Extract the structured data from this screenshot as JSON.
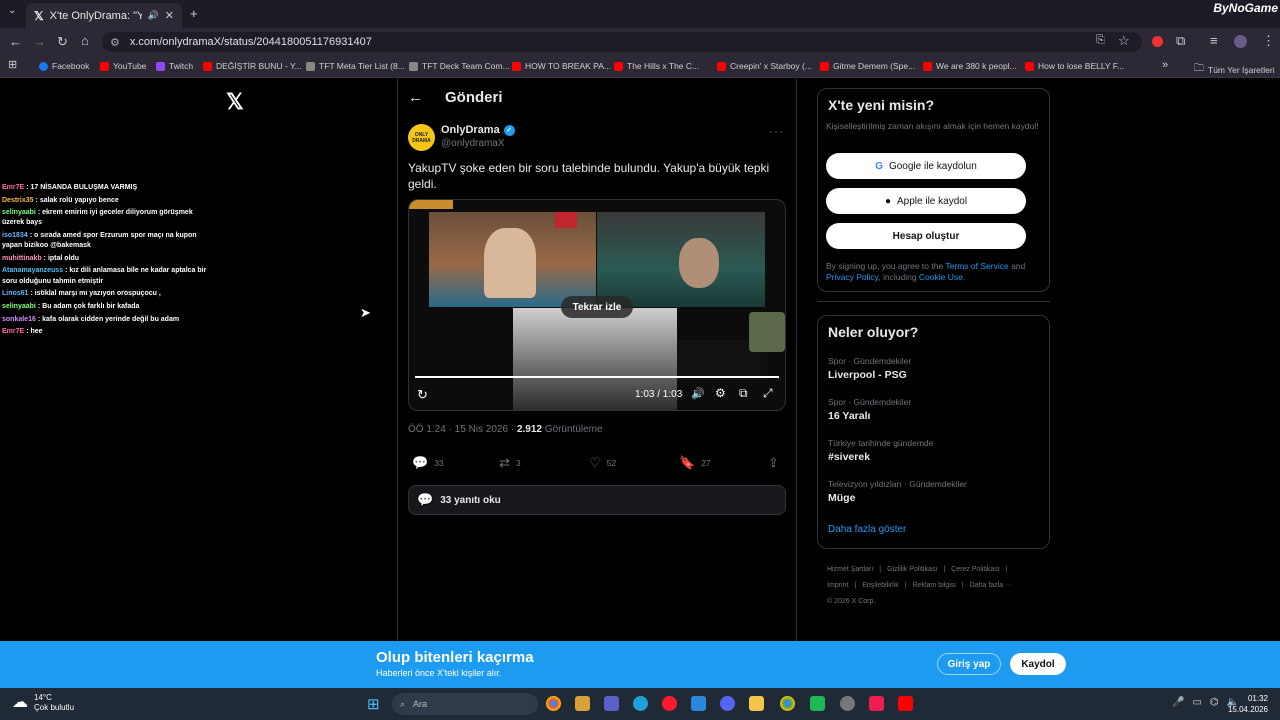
{
  "browser": {
    "tab_title": "X'te OnlyDrama: \"YakupTV ",
    "url": "x.com/onlydramaX/status/2044180051176931407",
    "brand": "ByNoGame",
    "bookmarks": [
      {
        "label": "Facebook",
        "color": "#1877f2"
      },
      {
        "label": "YouTube",
        "color": "#ff0000"
      },
      {
        "label": "Twitch",
        "color": "#9146ff"
      },
      {
        "label": "DEĞİŞTİR BUNU - Y...",
        "color": "#ff0000"
      },
      {
        "label": "TFT Meta Tier List (8...",
        "color": "#888888"
      },
      {
        "label": "TFT Deck Team Com...",
        "color": "#888888"
      },
      {
        "label": "HOW TO BREAK PA...",
        "color": "#ff0000"
      },
      {
        "label": "The Hills x The C...",
        "color": "#ff0000"
      },
      {
        "label": "Creepin' x Starboy (...",
        "color": "#ff0000"
      },
      {
        "label": "Gitme Demem (Spe...",
        "color": "#ff0000"
      },
      {
        "label": "We are 380 k peopl...",
        "color": "#ff0000"
      },
      {
        "label": "How to lose BELLY F...",
        "color": "#ff0000"
      }
    ],
    "all_bookmarks": "Tüm Yer İşaretleri"
  },
  "chat": [
    {
      "user": "Emr7E",
      "color": "#ff6b9a",
      "text": "17 NİSANDA BULUŞMA VARMIŞ"
    },
    {
      "user": "Destrix35",
      "color": "#ffb347",
      "text": "salak rolü yapıyo bence"
    },
    {
      "user": "selinyaabi",
      "color": "#7fff7f",
      "text": "ekrem emirim iyi geceler diliyorum görüşmek üzerek bays"
    },
    {
      "user": "iso1834",
      "color": "#6fb6ff",
      "text": "o sırada amed spor Erzurum spor maçı na kupon yapan bizikoo @bakemask"
    },
    {
      "user": "muhittinakb",
      "color": "#ff8fb1",
      "text": "iptal oldu"
    },
    {
      "user": "Atanamayanzeuss",
      "color": "#4fc3f7",
      "text": "kız dili anlamasa bile ne kadar aptalca bir soru olduğunu tahmin etmiştir"
    },
    {
      "user": "Linos61",
      "color": "#64b5f6",
      "text": "istiklal marşı mı yazıyon orospuçocu ,"
    },
    {
      "user": "selinyaabi",
      "color": "#7fff7f",
      "text": "Bu adam çok farklı bir kafada"
    },
    {
      "user": "sonkale16",
      "color": "#d18cff",
      "text": "kafa olarak cidden yerinde değil bu adam"
    },
    {
      "user": "Emr7E",
      "color": "#ff6b9a",
      "text": "hee"
    }
  ],
  "post": {
    "header": "Gönderi",
    "author": "OnlyDrama",
    "handle": "@onlydramaX",
    "text": "YakupTV şoke eden bir soru talebinde bulundu. Yakup'a büyük tepki geldi.",
    "replay_label": "Tekrar izle",
    "video_time": "1:03 / 1:03",
    "time": "ÖÖ 1:24 · 15 Nis 2026 · ",
    "views": "2.912",
    "views_label": " Görüntüleme",
    "replies": "33",
    "reposts": "3",
    "likes": "52",
    "bookmarks": "27",
    "read_replies": "33 yanıtı oku",
    "video_progress": 1.0
  },
  "signup": {
    "title": "X'te yeni misin?",
    "desc": "Kişiselleştirilmiş zaman akışını almak için hemen kaydol!",
    "google": "Google ile kaydolun",
    "apple": "Apple ile kaydol",
    "create": "Hesap oluştur",
    "legal_1": "By signing up, you agree to the ",
    "terms": "Terms of Service",
    "legal_2": " and ",
    "privacy": "Privacy Policy",
    "legal_3": ", including ",
    "cookie": "Cookie Use",
    "legal_4": "."
  },
  "trends": {
    "title": "Neler oluyor?",
    "items": [
      {
        "context": "Spor · Gündemdekiler",
        "name": "Liverpool - PSG"
      },
      {
        "context": "Spor · Gündemdekiler",
        "name": "16 Yaralı"
      },
      {
        "context": "Türkiye tarihinde gündemde",
        "name": "#siverek"
      },
      {
        "context": "Televizyon yıldızları · Gündemdekiler",
        "name": "Müge"
      }
    ],
    "show_more": "Daha fazla göster"
  },
  "footer": [
    "Hizmet Şartları",
    "|",
    "Gizlilik Politikası",
    "|",
    "Çerez Politikası",
    "|",
    "Imprint",
    "|",
    "Erişilebilirlik",
    "|",
    "Reklam bilgisi",
    "|",
    "Daha fazla ···",
    "© 2026 X Corp."
  ],
  "banner": {
    "title": "Olup bitenleri kaçırma",
    "subtitle": "Haberleri önce X'teki kişiler alır.",
    "login": "Giriş yap",
    "register": "Kaydol"
  },
  "taskbar": {
    "temp": "14°C",
    "weather": "Çok bulutlu",
    "search": "Ara",
    "time": "01:32",
    "date": "15.04.2026"
  }
}
